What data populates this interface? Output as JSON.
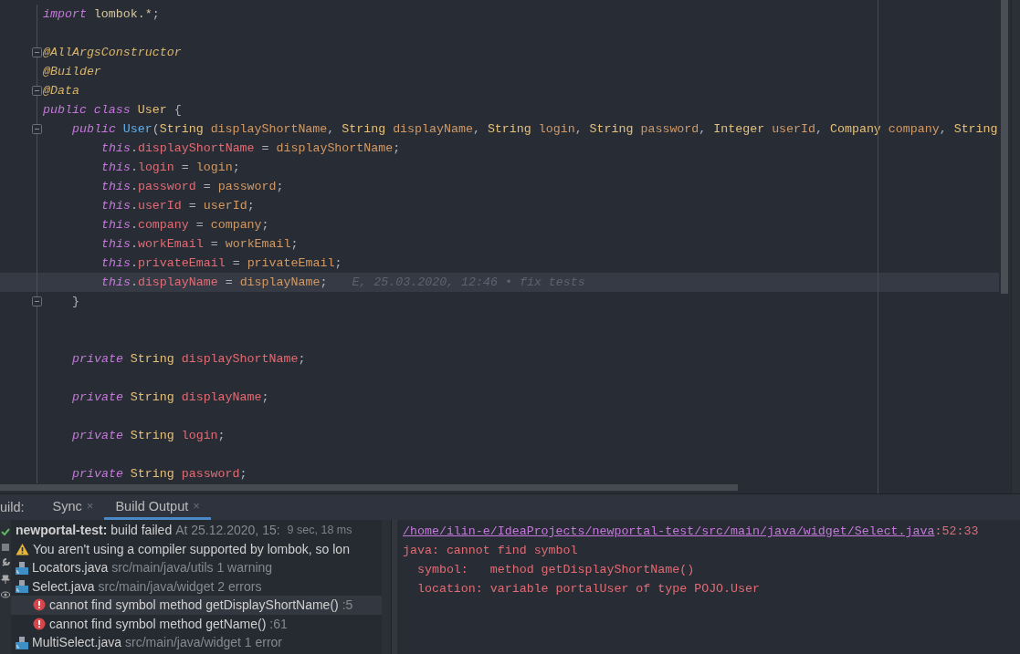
{
  "editor": {
    "lines": [
      {
        "kind": "code",
        "fold": false,
        "current": false,
        "tokens": [
          {
            "kind": "keyword",
            "text": "import "
          },
          {
            "kind": "package",
            "text": "lombok.*"
          },
          {
            "kind": "plain",
            "text": ";"
          }
        ]
      },
      {
        "kind": "blank",
        "fold": false,
        "current": false
      },
      {
        "kind": "code",
        "fold": true,
        "current": false,
        "tokens": [
          {
            "kind": "annotation",
            "text": "@AllArgsConstructor"
          }
        ]
      },
      {
        "kind": "code",
        "fold": false,
        "current": false,
        "tokens": [
          {
            "kind": "annotation",
            "text": "@Builder"
          }
        ]
      },
      {
        "kind": "code",
        "fold": true,
        "current": false,
        "tokens": [
          {
            "kind": "annotation",
            "text": "@Data"
          }
        ]
      },
      {
        "kind": "code",
        "fold": false,
        "current": false,
        "tokens": [
          {
            "kind": "keyword",
            "text": "public "
          },
          {
            "kind": "keyword",
            "text": "class "
          },
          {
            "kind": "type",
            "text": "User "
          },
          {
            "kind": "plain",
            "text": "{"
          }
        ],
        "children": [
          {
            "kind": "code",
            "fold": true,
            "current": false,
            "tokens": [
              {
                "kind": "keyword",
                "text": "public "
              },
              {
                "kind": "method",
                "text": "User"
              },
              {
                "kind": "plain",
                "text": "("
              },
              {
                "kind": "type",
                "text": "String "
              },
              {
                "kind": "param",
                "text": "displayShortName"
              },
              {
                "kind": "plain",
                "text": ", "
              },
              {
                "kind": "type",
                "text": "String "
              },
              {
                "kind": "param",
                "text": "displayName"
              },
              {
                "kind": "plain",
                "text": ", "
              },
              {
                "kind": "type",
                "text": "String "
              },
              {
                "kind": "param",
                "text": "login"
              },
              {
                "kind": "plain",
                "text": ", "
              },
              {
                "kind": "type",
                "text": "String "
              },
              {
                "kind": "param",
                "text": "password"
              },
              {
                "kind": "plain",
                "text": ", "
              },
              {
                "kind": "type",
                "text": "Integer "
              },
              {
                "kind": "param",
                "text": "userId"
              },
              {
                "kind": "plain",
                "text": ", "
              },
              {
                "kind": "type",
                "text": "Company "
              },
              {
                "kind": "param",
                "text": "company"
              },
              {
                "kind": "plain",
                "text": ", "
              },
              {
                "kind": "type",
                "text": "String"
              }
            ],
            "children": [
              {
                "kind": "code",
                "fold": false,
                "current": false,
                "tokens": [
                  {
                    "kind": "keyword",
                    "text": "this"
                  },
                  {
                    "kind": "plain",
                    "text": "."
                  },
                  {
                    "kind": "field",
                    "text": "displayShortName"
                  },
                  {
                    "kind": "plain",
                    "text": " = "
                  },
                  {
                    "kind": "param",
                    "text": "displayShortName"
                  },
                  {
                    "kind": "plain",
                    "text": ";"
                  }
                ]
              },
              {
                "kind": "code",
                "fold": false,
                "current": false,
                "tokens": [
                  {
                    "kind": "keyword",
                    "text": "this"
                  },
                  {
                    "kind": "plain",
                    "text": "."
                  },
                  {
                    "kind": "field",
                    "text": "login"
                  },
                  {
                    "kind": "plain",
                    "text": " = "
                  },
                  {
                    "kind": "param",
                    "text": "login"
                  },
                  {
                    "kind": "plain",
                    "text": ";"
                  }
                ]
              },
              {
                "kind": "code",
                "fold": false,
                "current": false,
                "tokens": [
                  {
                    "kind": "keyword",
                    "text": "this"
                  },
                  {
                    "kind": "plain",
                    "text": "."
                  },
                  {
                    "kind": "field",
                    "text": "password"
                  },
                  {
                    "kind": "plain",
                    "text": " = "
                  },
                  {
                    "kind": "param",
                    "text": "password"
                  },
                  {
                    "kind": "plain",
                    "text": ";"
                  }
                ]
              },
              {
                "kind": "code",
                "fold": false,
                "current": false,
                "tokens": [
                  {
                    "kind": "keyword",
                    "text": "this"
                  },
                  {
                    "kind": "plain",
                    "text": "."
                  },
                  {
                    "kind": "field",
                    "text": "userId"
                  },
                  {
                    "kind": "plain",
                    "text": " = "
                  },
                  {
                    "kind": "param",
                    "text": "userId"
                  },
                  {
                    "kind": "plain",
                    "text": ";"
                  }
                ]
              },
              {
                "kind": "code",
                "fold": false,
                "current": false,
                "tokens": [
                  {
                    "kind": "keyword",
                    "text": "this"
                  },
                  {
                    "kind": "plain",
                    "text": "."
                  },
                  {
                    "kind": "field",
                    "text": "company"
                  },
                  {
                    "kind": "plain",
                    "text": " = "
                  },
                  {
                    "kind": "param",
                    "text": "company"
                  },
                  {
                    "kind": "plain",
                    "text": ";"
                  }
                ]
              },
              {
                "kind": "code",
                "fold": false,
                "current": false,
                "tokens": [
                  {
                    "kind": "keyword",
                    "text": "this"
                  },
                  {
                    "kind": "plain",
                    "text": "."
                  },
                  {
                    "kind": "field",
                    "text": "workEmail"
                  },
                  {
                    "kind": "plain",
                    "text": " = "
                  },
                  {
                    "kind": "param",
                    "text": "workEmail"
                  },
                  {
                    "kind": "plain",
                    "text": ";"
                  }
                ]
              },
              {
                "kind": "code",
                "fold": false,
                "current": false,
                "tokens": [
                  {
                    "kind": "keyword",
                    "text": "this"
                  },
                  {
                    "kind": "plain",
                    "text": "."
                  },
                  {
                    "kind": "field",
                    "text": "privateEmail"
                  },
                  {
                    "kind": "plain",
                    "text": " = "
                  },
                  {
                    "kind": "param",
                    "text": "privateEmail"
                  },
                  {
                    "kind": "plain",
                    "text": ";"
                  }
                ]
              },
              {
                "kind": "code",
                "fold": false,
                "current": true,
                "blame": "E, 25.03.2020, 12:46 • fix tests",
                "tokens": [
                  {
                    "kind": "keyword",
                    "text": "this"
                  },
                  {
                    "kind": "plain",
                    "text": "."
                  },
                  {
                    "kind": "field",
                    "text": "displayName"
                  },
                  {
                    "kind": "plain",
                    "text": " = "
                  },
                  {
                    "kind": "param",
                    "text": "displayName"
                  },
                  {
                    "kind": "plain",
                    "text": ";"
                  }
                ]
              }
            ]
          },
          {
            "kind": "code",
            "fold": true,
            "current": false,
            "tokens": [
              {
                "kind": "plain",
                "text": "}"
              }
            ]
          },
          {
            "kind": "blank",
            "fold": false,
            "current": false
          },
          {
            "kind": "blank",
            "fold": false,
            "current": false
          },
          {
            "kind": "code",
            "fold": false,
            "current": false,
            "tokens": [
              {
                "kind": "keyword",
                "text": "private "
              },
              {
                "kind": "type",
                "text": "String "
              },
              {
                "kind": "field",
                "text": "displayShortName"
              },
              {
                "kind": "plain",
                "text": ";"
              }
            ]
          },
          {
            "kind": "blank",
            "fold": false,
            "current": false
          },
          {
            "kind": "code",
            "fold": false,
            "current": false,
            "tokens": [
              {
                "kind": "keyword",
                "text": "private "
              },
              {
                "kind": "type",
                "text": "String "
              },
              {
                "kind": "field",
                "text": "displayName"
              },
              {
                "kind": "plain",
                "text": ";"
              }
            ]
          },
          {
            "kind": "blank",
            "fold": false,
            "current": false
          },
          {
            "kind": "code",
            "fold": false,
            "current": false,
            "tokens": [
              {
                "kind": "keyword",
                "text": "private "
              },
              {
                "kind": "type",
                "text": "String "
              },
              {
                "kind": "field",
                "text": "login"
              },
              {
                "kind": "plain",
                "text": ";"
              }
            ]
          },
          {
            "kind": "blank",
            "fold": false,
            "current": false
          },
          {
            "kind": "code",
            "fold": false,
            "current": false,
            "tokens": [
              {
                "kind": "keyword",
                "text": "private "
              },
              {
                "kind": "type",
                "text": "String "
              },
              {
                "kind": "field",
                "text": "password"
              },
              {
                "kind": "plain",
                "text": ";"
              }
            ]
          }
        ]
      }
    ]
  },
  "build": {
    "label": "uild:",
    "tabs": [
      {
        "label": "Sync",
        "close": "×",
        "selected": false
      },
      {
        "label": "Build Output",
        "close": "×",
        "selected": true
      }
    ],
    "tree": [
      {
        "kind": "header",
        "selected": false,
        "text": "**newportal-test:** build failed",
        "detail": "At 25.12.2020, 15:",
        "extra": "9 sec, 18 ms"
      },
      {
        "kind": "warning",
        "selected": false,
        "text": "You aren't using a compiler supported by lombok, so lon"
      },
      {
        "kind": "file",
        "selected": false,
        "text": "Locators.java",
        "detail": "src/main/java/utils 1 warning"
      },
      {
        "kind": "file",
        "selected": false,
        "text": "Select.java",
        "detail": "src/main/java/widget 2 errors",
        "children": [
          {
            "kind": "error",
            "selected": true,
            "text": "cannot find symbol method getDisplayShortName()",
            "detail": ":5"
          },
          {
            "kind": "error",
            "selected": false,
            "text": "cannot find symbol method getName()",
            "detail": ":61"
          }
        ]
      },
      {
        "kind": "file",
        "selected": false,
        "text": "MultiSelect.java",
        "detail": "src/main/java/widget 1 error"
      }
    ],
    "console": [
      {
        "kind": "link",
        "link": "/home/ilin-e/IdeaProjects/newportal-test/src/main/java/widget/Select.java",
        "text": ":52:33"
      },
      {
        "kind": "text",
        "text": "java: cannot find symbol"
      },
      {
        "kind": "text",
        "text": "  symbol:   method getDisplayShortName()"
      },
      {
        "kind": "text",
        "text": "  location: variable portalUser of type POJO.User"
      }
    ]
  }
}
